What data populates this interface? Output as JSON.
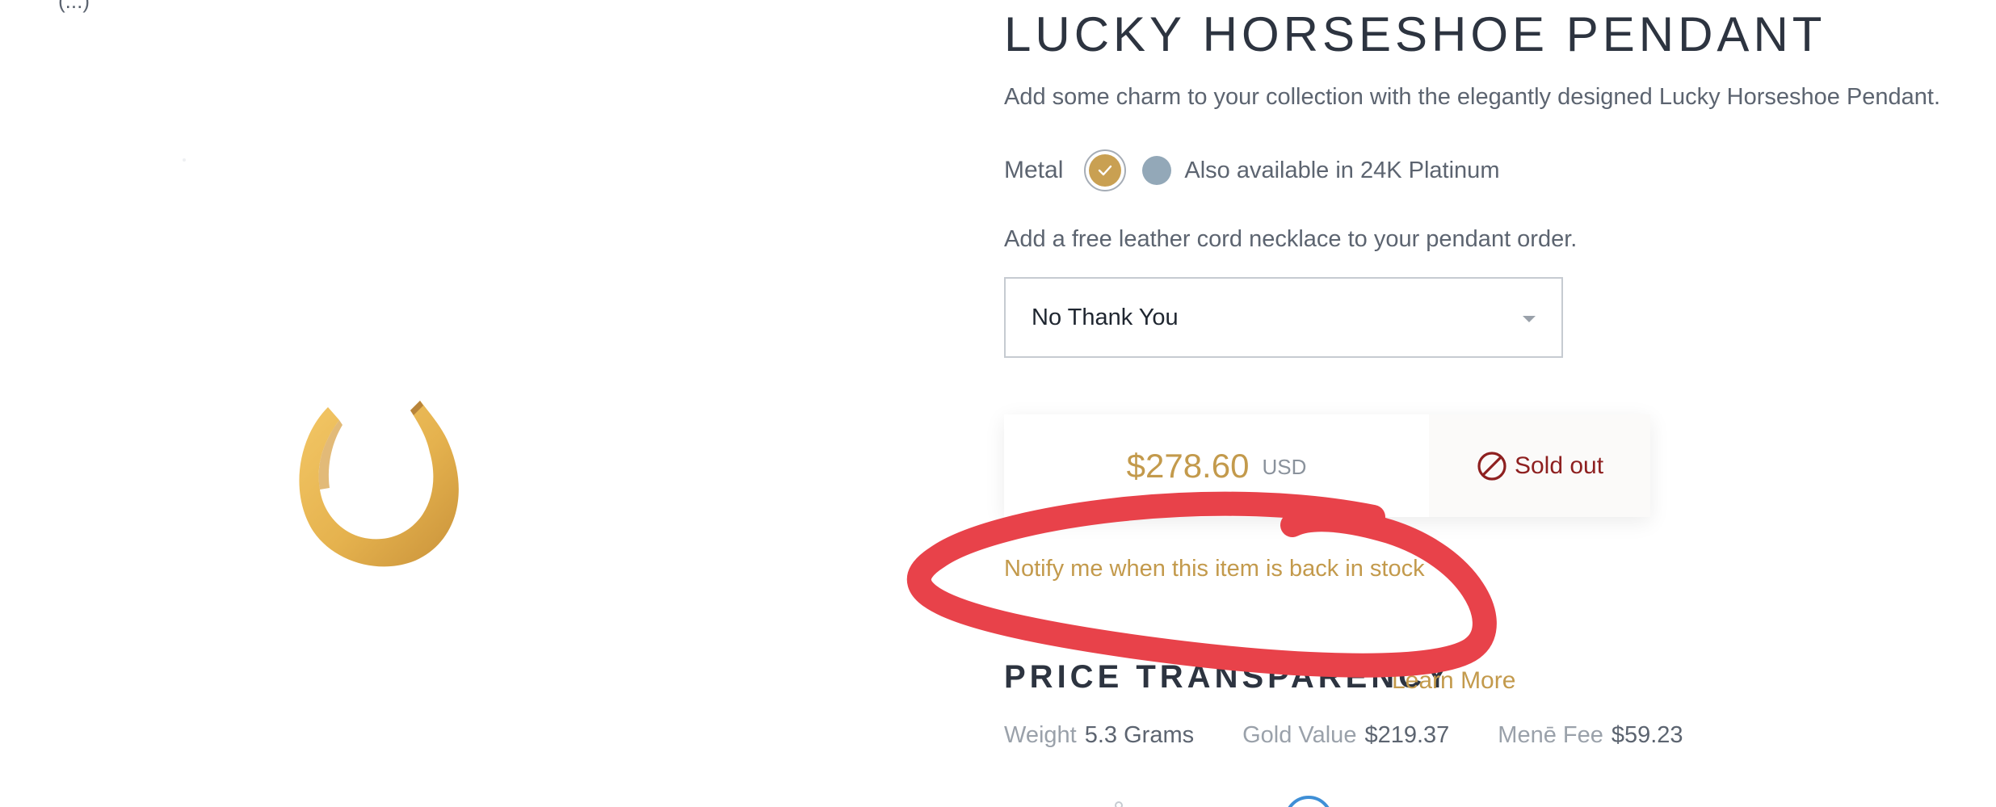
{
  "top_fragment": "(...)",
  "product": {
    "title": "LUCKY HORSESHOE PENDANT",
    "description": "Add some charm to your collection with the elegantly designed Lucky Horseshoe Pendant.",
    "image_icon": "horseshoe-pendant-image"
  },
  "metal": {
    "label": "Metal",
    "selected_color": "#c9a052",
    "alt_color": "#93a8b8",
    "alt_text": "Also available in 24K Platinum"
  },
  "cord": {
    "prompt": "Add a free leather cord necklace to your pendant order.",
    "selected_option": "No Thank You"
  },
  "price": {
    "amount": "$278.60",
    "currency": "USD",
    "status_label": "Sold out",
    "status_icon": "prohibited-icon",
    "status_color": "#8e2020"
  },
  "notify": {
    "label": "Notify me when this item is back in stock"
  },
  "price_transparency": {
    "heading": "PRICE TRANSPARENCY",
    "learn_more": "Learn More",
    "stats": [
      {
        "label": "Weight",
        "value": "5.3 Grams"
      },
      {
        "label": "Gold Value",
        "value": "$219.37"
      },
      {
        "label": "Menē Fee",
        "value": "$59.23"
      }
    ]
  },
  "colors": {
    "accent_gold": "#c39a4c",
    "annotation_red": "#e8424a"
  }
}
